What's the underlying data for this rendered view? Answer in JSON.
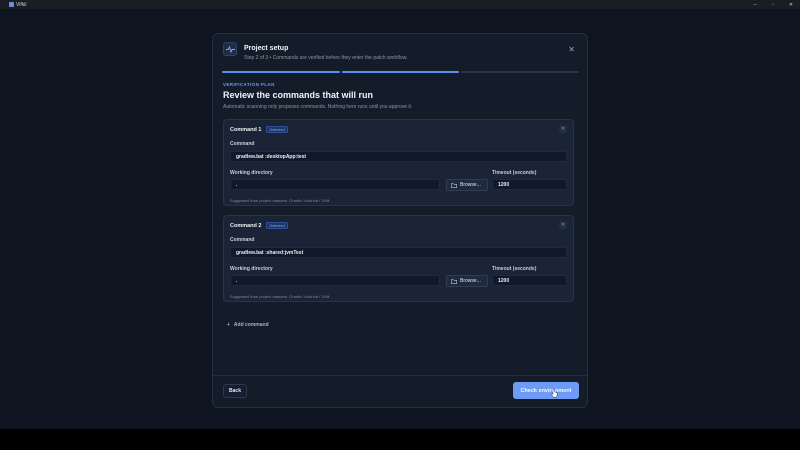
{
  "window": {
    "title": "Vifkil"
  },
  "dialog": {
    "title": "Project setup",
    "subtitle": "Step 2 of 3 • Commands are verified before they enter the patch workflow.",
    "step_total": 3,
    "step_current": 2,
    "section_overline": "VERIFICATION PLAN",
    "heading": "Review the commands that will run",
    "description": "Automatic scanning only proposes commands. Nothing here runs until you approve it.",
    "commands": [
      {
        "title": "Command 1",
        "badge": "Detected",
        "command_label": "Command",
        "command_value": "gradlew.bat :desktopApp:test",
        "workdir_label": "Working directory",
        "workdir_value": ".",
        "browse_label": "Browse...",
        "timeout_label": "Timeout (seconds)",
        "timeout_value": "1200",
        "hint": "Suggested from project markers: Gradle / Android / JVM."
      },
      {
        "title": "Command 2",
        "badge": "Detected",
        "command_label": "Command",
        "command_value": "gradlew.bat :shared:jvmTest",
        "workdir_label": "Working directory",
        "workdir_value": ".",
        "browse_label": "Browse...",
        "timeout_label": "Timeout (seconds)",
        "timeout_value": "1200",
        "hint": "Suggested from project markers: Gradle / Android / JVM."
      }
    ],
    "add_command_label": "Add command",
    "back_label": "Back",
    "primary_label": "Check environment"
  },
  "colors": {
    "accent": "#5b8ff0",
    "primary_button": "#6d9bf5",
    "dialog_bg": "#141c2a",
    "card_bg": "#1a2436"
  },
  "icons": {
    "header": "activity-icon",
    "close": "close-icon",
    "remove": "close-icon",
    "browse": "folder-icon",
    "add": "plus-icon"
  }
}
